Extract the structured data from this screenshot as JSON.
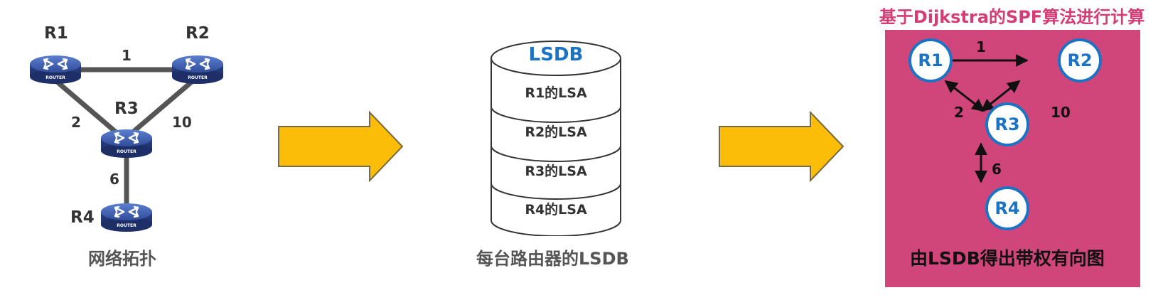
{
  "topology": {
    "routers": [
      {
        "name": "R1",
        "icon_label": "ROUTER"
      },
      {
        "name": "R2",
        "icon_label": "ROUTER"
      },
      {
        "name": "R3",
        "icon_label": "ROUTER"
      },
      {
        "name": "R4",
        "icon_label": "ROUTER"
      }
    ],
    "links": [
      {
        "from": "R1",
        "to": "R2",
        "cost": "1"
      },
      {
        "from": "R1",
        "to": "R3",
        "cost": "2"
      },
      {
        "from": "R2",
        "to": "R3",
        "cost": "10"
      },
      {
        "from": "R3",
        "to": "R4",
        "cost": "6"
      }
    ],
    "caption": "网络拓扑"
  },
  "lsdb": {
    "title": "LSDB",
    "rows": [
      "R1的LSA",
      "R2的LSA",
      "R3的LSA",
      "R4的LSA"
    ],
    "caption": "每台路由器的LSDB"
  },
  "graph_panel": {
    "title": "基于Dijkstra的SPF算法进行计算",
    "nodes": [
      "R1",
      "R2",
      "R3",
      "R4"
    ],
    "edges": [
      {
        "from": "R1",
        "to": "R2",
        "cost": "1"
      },
      {
        "from": "R1",
        "to": "R3",
        "cost": "2"
      },
      {
        "from": "R2",
        "to": "R3",
        "cost": "10"
      },
      {
        "from": "R3",
        "to": "R4",
        "cost": "6"
      }
    ],
    "caption": "由LSDB得出带权有向图"
  },
  "colors": {
    "arrow_fill": "#fbbd07",
    "panel_bg": "#d0467a",
    "node_border": "#1b73c4",
    "router_blue": "#3a5aa8",
    "link_gray": "#555555"
  }
}
